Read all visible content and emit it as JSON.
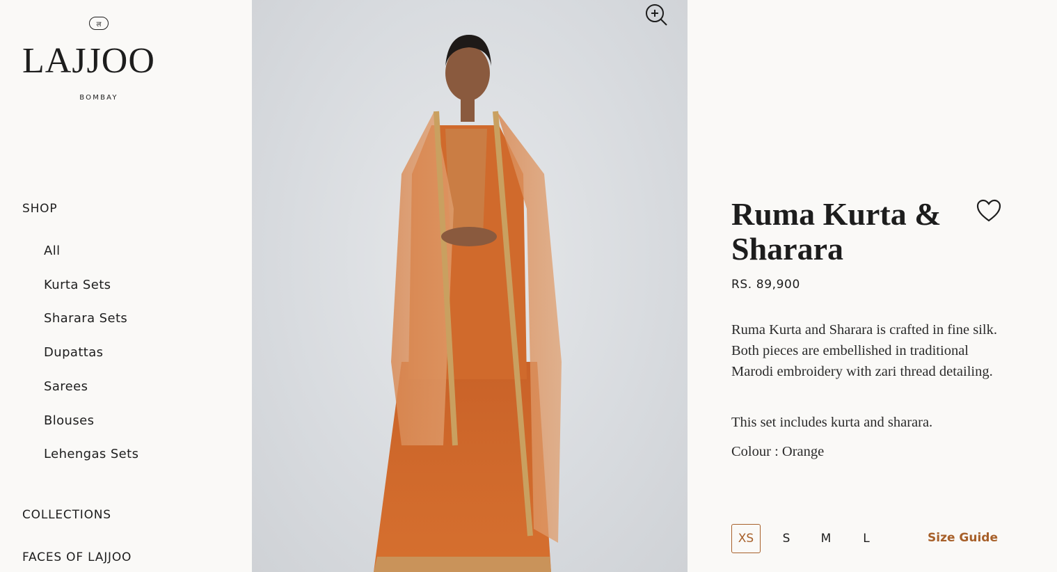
{
  "brand": {
    "mark": "ल",
    "name": "LAJJOO",
    "subtitle": "BOMBAY"
  },
  "nav": {
    "shop": "SHOP",
    "shop_items": [
      "All",
      "Kurta Sets",
      "Sharara Sets",
      "Dupattas",
      "Sarees",
      "Blouses",
      "Lehengas Sets"
    ],
    "collections": "COLLECTIONS",
    "faces": "FACES OF LAJJOO"
  },
  "product": {
    "title": "Ruma Kurta & Sharara",
    "price": "RS. 89,900",
    "description": "Ruma Kurta and Sharara is crafted in fine silk. Both pieces are embellished in traditional Marodi embroidery with zari thread detailing.",
    "includes": "This set includes kurta and sharara.",
    "colour_label": "Colour : ",
    "colour_value": "Orange",
    "sizes": [
      "XS",
      "S",
      "M",
      "L"
    ],
    "selected_size": "XS",
    "size_guide": "Size Guide"
  },
  "icons": {
    "zoom": "zoom-in-icon",
    "wishlist": "heart-icon"
  },
  "colors": {
    "accent": "#a7602a",
    "background": "#faf9f7",
    "garment": "#d9702c"
  }
}
